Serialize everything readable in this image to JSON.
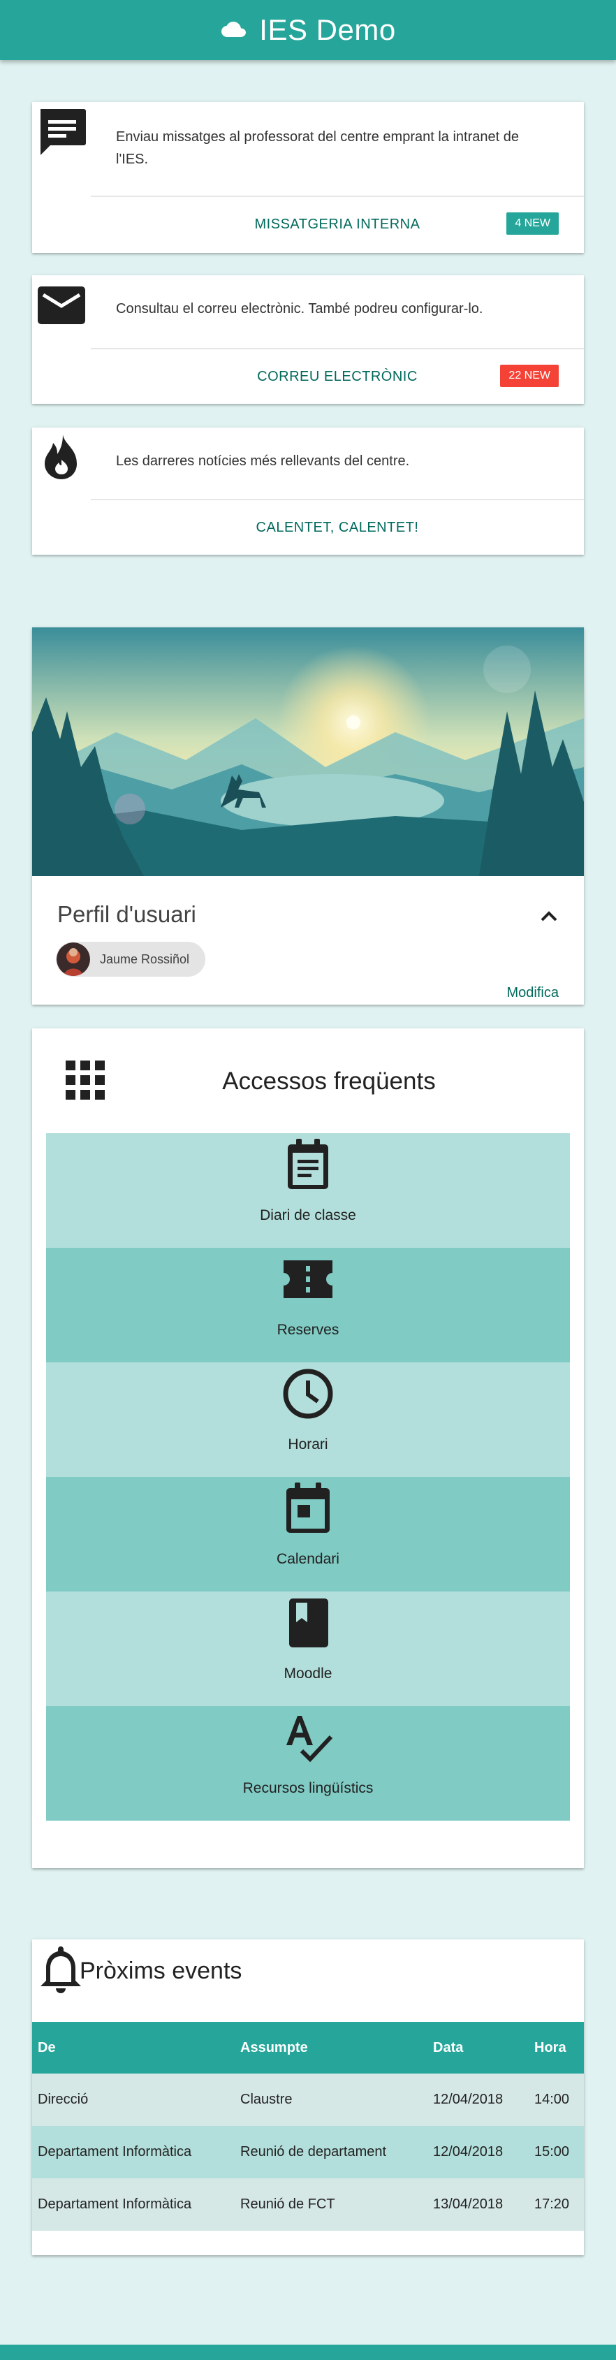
{
  "app": {
    "title": "IES Demo",
    "icon": "cloud-icon"
  },
  "notifications": [
    {
      "icon": "message-icon",
      "text": "Enviau missatges al professorat del centre emprant la intranet de l'IES.",
      "action": "MISSATGERIA INTERNA",
      "badge": "4 NEW",
      "badge_color": "#26a69a"
    },
    {
      "icon": "mail-icon",
      "text": "Consultau el correu electrònic. També podreu configurar-lo.",
      "action": "CORREU ELECTRÒNIC",
      "badge": "22 NEW",
      "badge_color": "#f44336"
    },
    {
      "icon": "flame-icon",
      "text": "Les darreres notícies més rellevants del centre.",
      "action": "CALENTET, CALENTET!"
    }
  ],
  "profile": {
    "title": "Perfil d'usuari",
    "user_name": "Jaume Rossiñol",
    "edit_label": "Modifica"
  },
  "shortcuts": {
    "title": "Accessos freqüents",
    "items": [
      {
        "label": "Diari de classe",
        "icon": "assignment-icon"
      },
      {
        "label": "Reserves",
        "icon": "ticket-icon"
      },
      {
        "label": "Horari",
        "icon": "clock-icon"
      },
      {
        "label": "Calendari",
        "icon": "calendar-icon"
      },
      {
        "label": "Moodle",
        "icon": "book-icon"
      },
      {
        "label": "Recursos lingüístics",
        "icon": "spellcheck-icon"
      }
    ]
  },
  "events": {
    "title": "Pròxims events",
    "columns": [
      "De",
      "Assumpte",
      "Data",
      "Hora"
    ],
    "rows": [
      [
        "Direcció",
        "Claustre",
        "12/04/2018",
        "14:00"
      ],
      [
        "Departament Informàtica",
        "Reunió de departament",
        "12/04/2018",
        "15:00"
      ],
      [
        "Departament Informàtica",
        "Reunió de FCT",
        "13/04/2018",
        "17:20"
      ]
    ]
  },
  "colors": {
    "primary": "#26a69a",
    "background": "#e0f2f1",
    "tile_light": "#b2dfdb",
    "tile_dark": "#80cbc4",
    "link": "#00695c",
    "badge_red": "#f44336"
  }
}
